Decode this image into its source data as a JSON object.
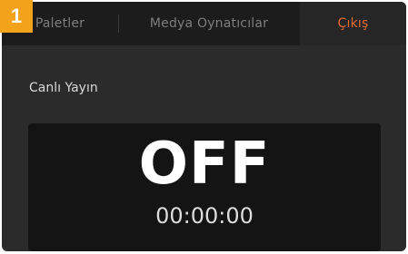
{
  "step_badge": "1",
  "tabs": [
    {
      "label": "Paletler"
    },
    {
      "label": "Medya Oynatıcılar"
    },
    {
      "label": "Çıkış"
    }
  ],
  "live": {
    "section_label": "Canlı Yayın",
    "status": "OFF",
    "timecode": "00:00:00"
  },
  "colors": {
    "accent": "#e56b33",
    "badge": "#f3a21c"
  }
}
